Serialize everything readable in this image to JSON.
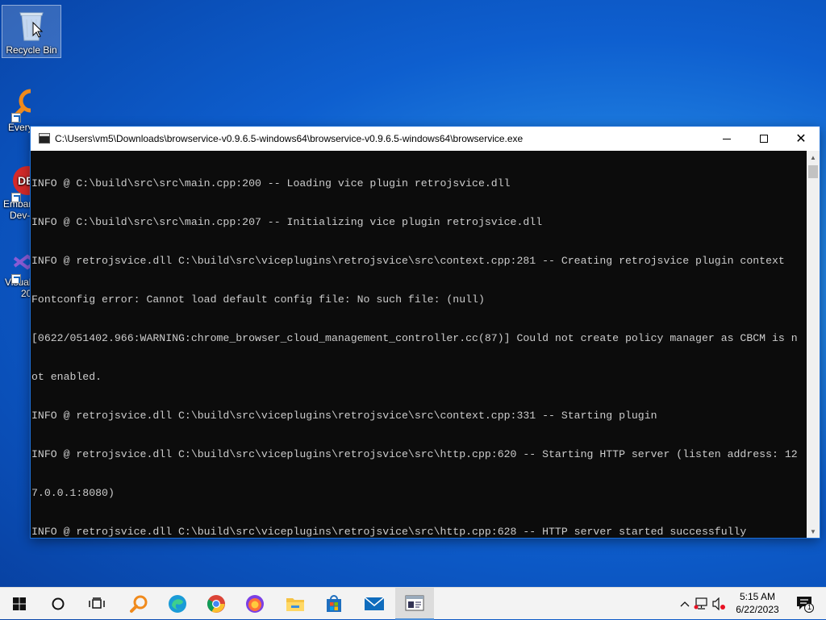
{
  "desktop": {
    "icons": [
      {
        "label": "Recycle Bin"
      },
      {
        "label": "Every"
      },
      {
        "label": "Embar"
      },
      {
        "label": "Dev-"
      },
      {
        "label": "Visual"
      },
      {
        "label": "20"
      }
    ]
  },
  "window": {
    "title": "C:\\Users\\vm5\\Downloads\\browservice-v0.9.6.5-windows64\\browservice-v0.9.6.5-windows64\\browservice.exe",
    "minimize_label": "—",
    "close_label": "✕",
    "lines": [
      "INFO @ C:\\build\\src\\src\\main.cpp:200 -- Loading vice plugin retrojsvice.dll",
      "INFO @ C:\\build\\src\\src\\main.cpp:207 -- Initializing vice plugin retrojsvice.dll",
      "INFO @ retrojsvice.dll C:\\build\\src\\viceplugins\\retrojsvice\\src\\context.cpp:281 -- Creating retrojsvice plugin context",
      "Fontconfig error: Cannot load default config file: No such file: (null)",
      "[0622/051402.966:WARNING:chrome_browser_cloud_management_controller.cc(87)] Could not create policy manager as CBCM is n",
      "ot enabled.",
      "INFO @ retrojsvice.dll C:\\build\\src\\viceplugins\\retrojsvice\\src\\context.cpp:331 -- Starting plugin",
      "INFO @ retrojsvice.dll C:\\build\\src\\viceplugins\\retrojsvice\\src\\http.cpp:620 -- Starting HTTP server (listen address: 12",
      "7.0.0.1:8080)",
      "INFO @ retrojsvice.dll C:\\build\\src\\viceplugins\\retrojsvice\\src\\http.cpp:628 -- HTTP server started successfully"
    ]
  },
  "taskbar": {
    "clock_time": "5:15 AM",
    "clock_date": "6/22/2023",
    "notification_count": "1",
    "apps": [
      "start",
      "search",
      "task-view",
      "everything",
      "edge",
      "chrome",
      "firefox",
      "file-explorer",
      "store",
      "mail",
      "console"
    ]
  },
  "colors": {
    "console_bg": "#0c0c0c",
    "console_text": "#cccccc",
    "accent": "#0078d7"
  }
}
